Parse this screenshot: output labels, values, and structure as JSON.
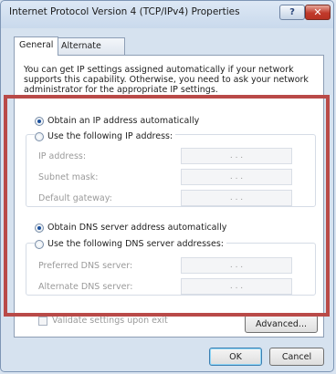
{
  "window": {
    "title": "Internet Protocol Version 4 (TCP/IPv4) Properties",
    "help_label": "?",
    "close_label": "✕"
  },
  "tabs": [
    {
      "label": "General",
      "active": true
    },
    {
      "label": "Alternate Configuration",
      "active": false
    }
  ],
  "intro_text": "You can get IP settings assigned automatically if your network supports this capability. Otherwise, you need to ask your network administrator for the appropriate IP settings.",
  "ip": {
    "auto_label": "Obtain an IP address automatically",
    "manual_label": "Use the following IP address:",
    "selected": "auto",
    "fields": [
      {
        "label": "IP address:",
        "value": ". . ."
      },
      {
        "label": "Subnet mask:",
        "value": ". . ."
      },
      {
        "label": "Default gateway:",
        "value": ". . ."
      }
    ]
  },
  "dns": {
    "auto_label": "Obtain DNS server address automatically",
    "manual_label": "Use the following DNS server addresses:",
    "selected": "auto",
    "fields": [
      {
        "label": "Preferred DNS server:",
        "value": ". . ."
      },
      {
        "label": "Alternate DNS server:",
        "value": ". . ."
      }
    ]
  },
  "validate_label": "Validate settings upon exit",
  "buttons": {
    "advanced": "Advanced...",
    "ok": "OK",
    "cancel": "Cancel"
  },
  "colors": {
    "highlight_border": "#b94a48",
    "close_button": "#c1392b"
  },
  "icons": {
    "help": "help-icon",
    "close": "close-icon"
  }
}
